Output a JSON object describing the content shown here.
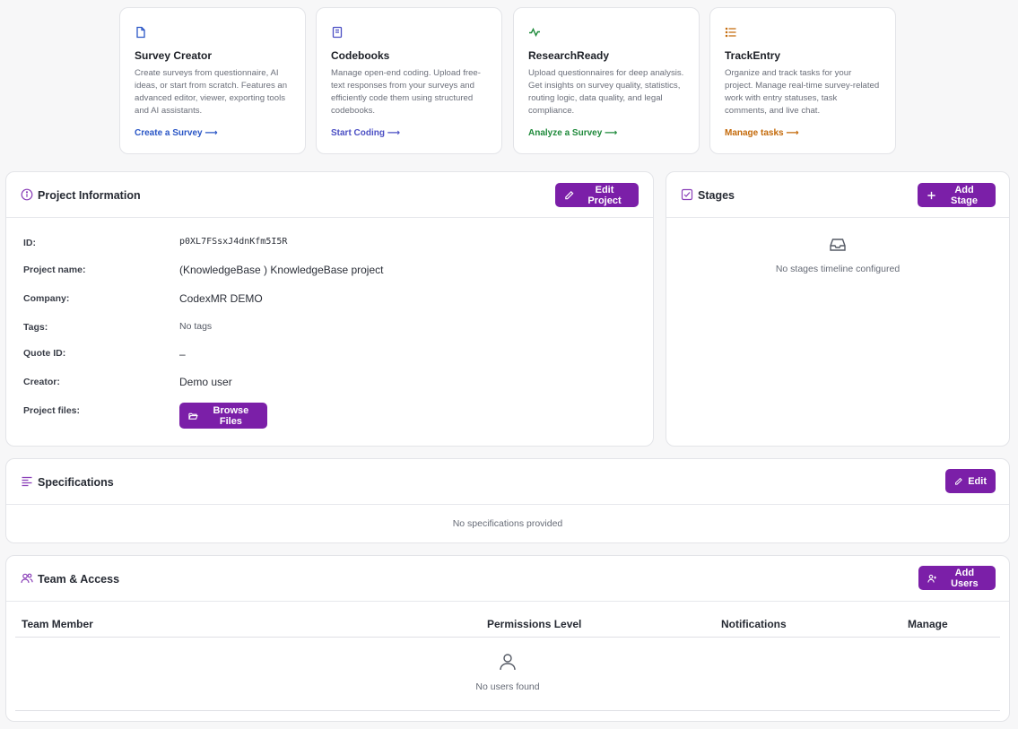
{
  "apps": [
    {
      "title": "Survey Creator",
      "description": "Create surveys from questionnaire, AI ideas, or start from scratch. Features an advanced editor, viewer, exporting tools and AI assistants.",
      "link": "Create a Survey ⟶",
      "color": "#2a56c6",
      "icon": "file-icon"
    },
    {
      "title": "Codebooks",
      "description": "Manage open-end coding. Upload free-text responses from your surveys and efficiently code them using structured codebooks.",
      "link": "Start Coding ⟶",
      "color": "#4b4fc4",
      "icon": "book-icon"
    },
    {
      "title": "ResearchReady",
      "description": "Upload questionnaires for deep analysis. Get insights on survey quality, statistics, routing logic, data quality, and legal compliance.",
      "link": "Analyze a Survey ⟶",
      "color": "#1f8a3b",
      "icon": "activity-icon"
    },
    {
      "title": "TrackEntry",
      "description": "Organize and track tasks for your project. Manage real-time survey-related work with entry statuses, task comments, and live chat.",
      "link": "Manage tasks ⟶",
      "color": "#c46a0a",
      "icon": "list-icon"
    }
  ],
  "project_info": {
    "title": "Project Information",
    "edit_label": "Edit Project",
    "rows": [
      {
        "label": "ID:",
        "value": "p0XL7FSsxJ4dnKfm5I5R"
      },
      {
        "label": "Project name:",
        "value": "(KnowledgeBase ) KnowledgeBase project"
      },
      {
        "label": "Company:",
        "value": "CodexMR DEMO"
      },
      {
        "label": "Tags:",
        "value": "No tags"
      },
      {
        "label": "Quote ID:",
        "value": "–"
      },
      {
        "label": "Creator:",
        "value": "Demo user"
      },
      {
        "label": "Project files:",
        "value": ""
      }
    ],
    "browse_label": "Browse Files"
  },
  "stages": {
    "title": "Stages",
    "add_label": "Add Stage",
    "empty_text": "No stages timeline configured"
  },
  "specifications": {
    "title": "Specifications",
    "edit_label": "Edit",
    "empty_text": "No specifications provided"
  },
  "team": {
    "title": "Team & Access",
    "add_label": "Add Users",
    "columns": [
      "Team Member",
      "Permissions Level",
      "Notifications",
      "Manage"
    ],
    "empty_text": "No users found"
  },
  "colors": {
    "accent": "#7b1fa8",
    "border": "#e3e4e8"
  }
}
